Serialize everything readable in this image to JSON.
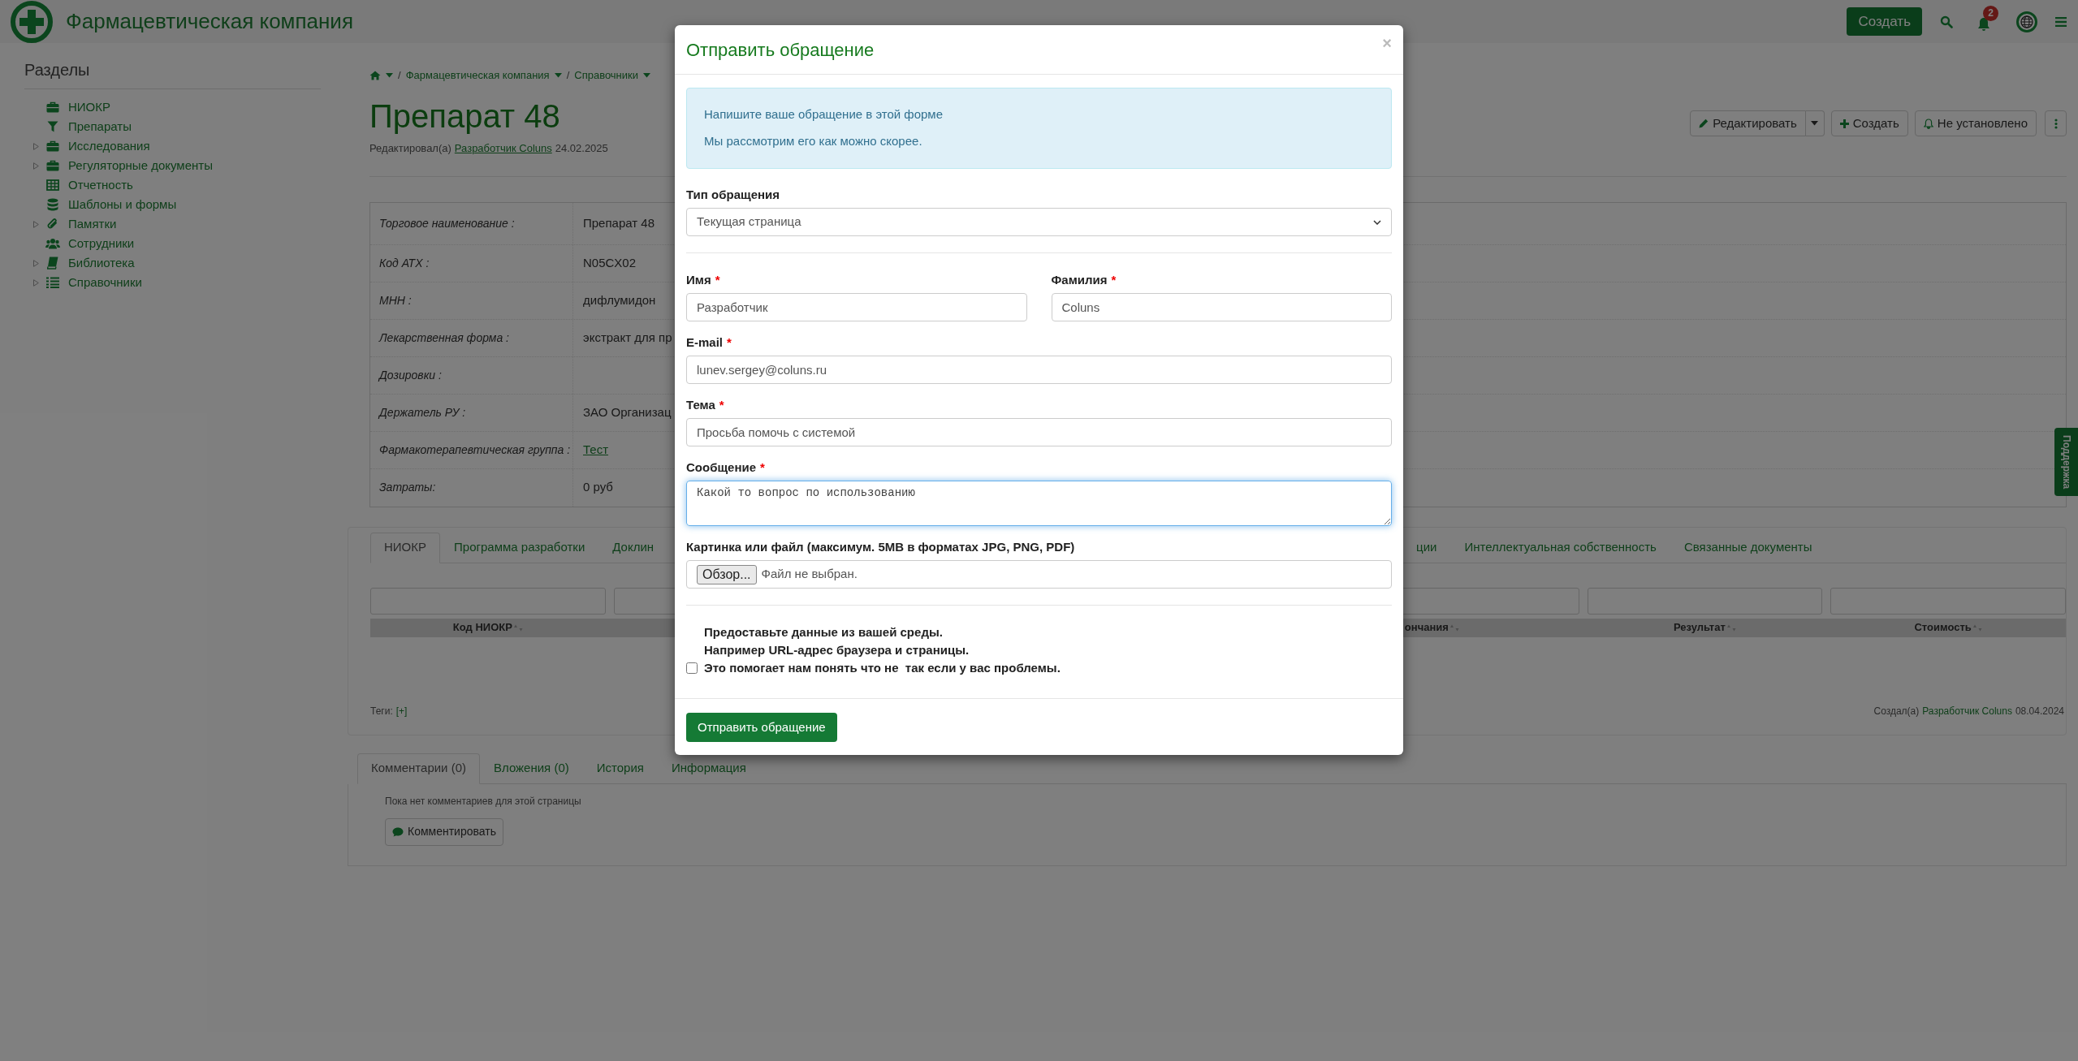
{
  "header": {
    "title": "Фармацевтическая компания",
    "create_button": "Создать",
    "notification_count": "2"
  },
  "sidebar": {
    "title": "Разделы",
    "items": [
      {
        "label": "НИОКР",
        "has_children": false
      },
      {
        "label": "Препараты",
        "has_children": false
      },
      {
        "label": "Исследования",
        "has_children": true
      },
      {
        "label": "Регуляторные документы",
        "has_children": true
      },
      {
        "label": "Отчетность",
        "has_children": false
      },
      {
        "label": "Шаблоны и формы",
        "has_children": false
      },
      {
        "label": "Памятки",
        "has_children": true
      },
      {
        "label": "Сотрудники",
        "has_children": false
      },
      {
        "label": "Библиотека",
        "has_children": true
      },
      {
        "label": "Справочники",
        "has_children": true
      }
    ]
  },
  "breadcrumb": [
    {
      "separator": "/",
      "label": "Фармацевтическая компания"
    },
    {
      "separator": "/",
      "label": "Справочники"
    }
  ],
  "page": {
    "title": "Препарат 48",
    "edited_prefix": "Редактировал(а)",
    "edited_by": "Разработчик Coluns",
    "edited_date": "24.02.2025"
  },
  "actions": [
    {
      "label": "Редактировать",
      "kind": "edit"
    },
    {
      "label": "Создать",
      "kind": "create"
    },
    {
      "label": "Не установлено",
      "kind": "subscribe"
    }
  ],
  "properties": [
    {
      "label": "Торговое наименование :",
      "value": "Препарат 48",
      "link": false
    },
    {
      "label": "Код АТХ :",
      "value": "N05CX02",
      "link": false
    },
    {
      "label": "МНН :",
      "value": "дифлумидон",
      "link": false
    },
    {
      "label": "Лекарственная форма :",
      "value": "экстракт для пр",
      "link": false
    },
    {
      "label": "Дозировки :"
    },
    {
      "label": "Держатель РУ :",
      "value": "ЗАО Организац",
      "link": false
    },
    {
      "label": "Фармакотерапевтическая группа :",
      "value": "Тест",
      "link": true
    },
    {
      "label": "Затраты:",
      "value": "0 руб",
      "link": false
    }
  ],
  "tabs": [
    {
      "label": "НИОКР",
      "selected": true
    },
    {
      "label": "Программа разработки",
      "selected": false
    },
    {
      "label": "Доклин",
      "selected": false
    },
    {
      "label": "ции",
      "selected": false
    },
    {
      "label": "Интеллектуальная собственность",
      "selected": false
    },
    {
      "label": "Связанные документы",
      "selected": false
    }
  ],
  "table": {
    "columns": [
      {
        "label": "Код НИОКР"
      },
      {
        "label": "ончания"
      },
      {
        "label": "Результат"
      },
      {
        "label": "Стоимость"
      }
    ]
  },
  "tags": {
    "label": "Теги:",
    "add": "[+]"
  },
  "created": {
    "prefix": "Создал(а)",
    "by": "Разработчик Coluns",
    "date": "08.04.2024"
  },
  "bottom_tabs": [
    {
      "label": "Комментарии (0)",
      "selected": true
    },
    {
      "label": "Вложения (0)",
      "selected": false
    },
    {
      "label": "История",
      "selected": false
    },
    {
      "label": "Информация",
      "selected": false
    }
  ],
  "comments": {
    "empty_text": "Пока нет комментариев для этой страницы",
    "button": "Комментировать"
  },
  "support_tab": "Поддержка",
  "modal": {
    "title": "Отправить обращение",
    "close": "×",
    "info": [
      "Напишите ваше обращение в этой форме",
      "Мы рассмотрим его как можно скорее."
    ],
    "type_field": {
      "label": "Тип обращения",
      "value": "Текущая страница"
    },
    "name_fields": [
      {
        "label": "Имя",
        "required_mark": "*",
        "value": "Разработчик"
      },
      {
        "label": "Фамилия",
        "required_mark": "*",
        "value": "Coluns"
      }
    ],
    "fields": [
      {
        "kind": "text",
        "label": "E-mail",
        "required_mark": "*",
        "value": "lunev.sergey@coluns.ru",
        "focused": false
      },
      {
        "kind": "text",
        "label": "Тема",
        "required_mark": "*",
        "value": "Просьба помочь с системой",
        "focused": false
      },
      {
        "kind": "textarea",
        "label": "Сообщение",
        "required_mark": "*",
        "value": "Какой то вопрос по использованию",
        "focused": true
      },
      {
        "kind": "file",
        "label": "Картинка или файл (максимум. 5MB в форматах JPG, PNG, PDF)",
        "button": "Обзор...",
        "status": "Файл не выбран."
      }
    ],
    "consent": {
      "lines": [
        "Предоставьте данные из вашей среды.",
        "Например URL-адрес браузера и страницы.",
        "Это помогает нам понять что не  так если у вас проблемы."
      ],
      "checked": false
    },
    "submit": "Отправить обращение"
  }
}
